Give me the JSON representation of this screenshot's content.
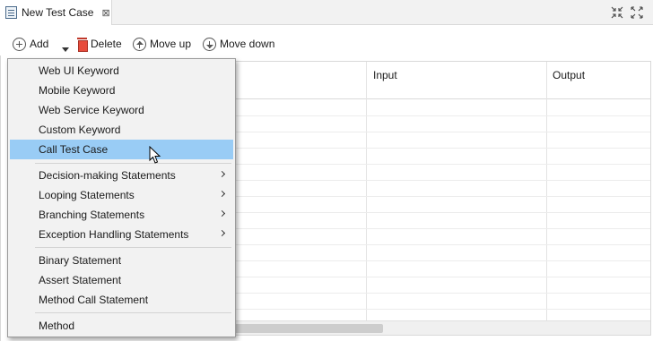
{
  "tab": {
    "title": "New Test Case",
    "close_glyph": "⊠"
  },
  "window_controls": [
    {
      "icon": "minimize-arrows-icon"
    },
    {
      "icon": "maximize-arrows-icon"
    }
  ],
  "toolbar": {
    "add_label": "Add",
    "delete_label": "Delete",
    "move_up_label": "Move up",
    "move_down_label": "Move down"
  },
  "table": {
    "columns": [
      "Input",
      "Output"
    ]
  },
  "menu": {
    "selected_item": "Call Test Case",
    "group_keywords": [
      "Web UI Keyword",
      "Mobile Keyword",
      "Web Service Keyword",
      "Custom Keyword",
      "Call Test Case"
    ],
    "group_statements": [
      "Decision-making Statements",
      "Looping Statements",
      "Branching Statements",
      "Exception Handling Statements"
    ],
    "group_simple": [
      "Binary Statement",
      "Assert Statement",
      "Method Call Statement"
    ],
    "group_method": [
      "Method"
    ]
  },
  "colors": {
    "menu_highlight": "#99ccf5",
    "menu_background": "#f2f2f2",
    "delete_icon": "#e74c3c"
  }
}
